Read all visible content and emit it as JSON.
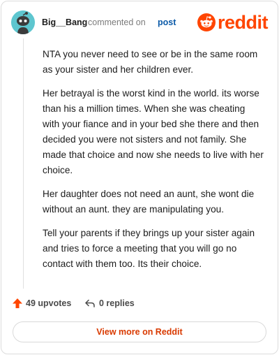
{
  "comment": {
    "username": "Big__Bang",
    "action_text": "commented on",
    "post_link": "post",
    "paragraphs": [
      "NTA you never need to see or be in the same room as your sister and her children ever.",
      "Her betrayal is the worst kind in the world. its worse than his a million times. When she was cheating with your fiance and in your bed she there and then decided you were not sisters and not family. She made that choice and now she needs to live with her choice.",
      "Her daughter does not need an aunt, she wont die without an aunt. they are manipulating you.",
      "Tell your parents if they brings up your sister again and tries to force a meeting that you will go no contact with them too. Its their choice."
    ],
    "upvotes_label": "49 upvotes",
    "replies_label": "0 replies"
  },
  "brand": {
    "logo_text": "reddit",
    "logo_icon": "reddit-alien-icon",
    "accent_color": "#ff4500",
    "link_color": "#0b5aa8",
    "avatar_color": "#5ec6cf"
  },
  "footer": {
    "view_more_label": "View more on Reddit"
  }
}
